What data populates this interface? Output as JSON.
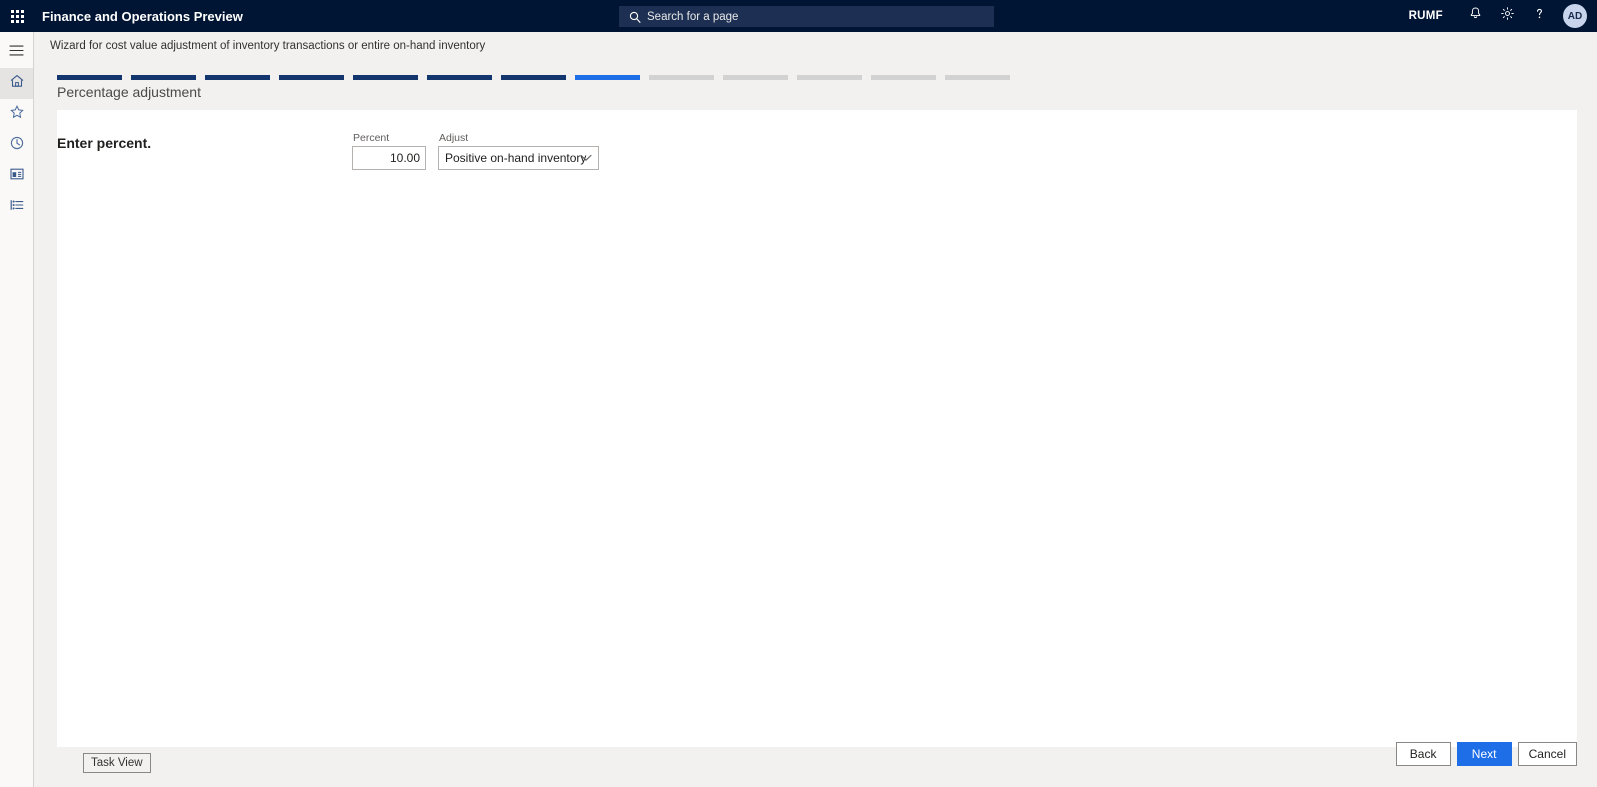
{
  "header": {
    "waffle_icon": "app-launcher-icon",
    "title": "Finance and Operations Preview",
    "search": {
      "icon": "search-icon",
      "placeholder": "Search for a page"
    },
    "company_label": "RUMF",
    "icons": [
      {
        "name": "notifications-bell-icon",
        "glyph": "bell"
      },
      {
        "name": "settings-gear-icon",
        "glyph": "gear"
      },
      {
        "name": "help-question-icon",
        "glyph": "question"
      }
    ],
    "avatar_initials": "AD",
    "colors": {
      "header_background": "#001433",
      "search_background": "#1d3053",
      "avatar_background": "#c7d4ec"
    }
  },
  "nav_rail": {
    "items": [
      {
        "name": "hamburger-menu",
        "icon": "hamburger-icon",
        "active": false
      },
      {
        "name": "home",
        "icon": "home-icon",
        "active": true
      },
      {
        "name": "favorites",
        "icon": "star-icon",
        "active": false
      },
      {
        "name": "recent",
        "icon": "clock-icon",
        "active": false
      },
      {
        "name": "workspaces",
        "icon": "workspace-icon",
        "active": false
      },
      {
        "name": "modules",
        "icon": "modules-list-icon",
        "active": false
      }
    ]
  },
  "breadcrumb": "Wizard for cost value adjustment of inventory transactions or entire on-hand inventory",
  "wizard": {
    "step_title": "Percentage adjustment",
    "total_steps": 13,
    "current_step": 8,
    "steps": [
      {
        "state": "done"
      },
      {
        "state": "done"
      },
      {
        "state": "done"
      },
      {
        "state": "done"
      },
      {
        "state": "done"
      },
      {
        "state": "done"
      },
      {
        "state": "done"
      },
      {
        "state": "current"
      },
      {
        "state": "todo"
      },
      {
        "state": "todo"
      },
      {
        "state": "todo"
      },
      {
        "state": "todo"
      },
      {
        "state": "todo"
      }
    ],
    "colors": {
      "done": "#14366f",
      "current": "#1e6ee8",
      "todo": "#d2d2d2"
    }
  },
  "content": {
    "section_heading": "Enter percent.",
    "fields": {
      "percent": {
        "label": "Percent",
        "value": "10.00"
      },
      "adjust": {
        "label": "Adjust",
        "value": "Positive on-hand inventory",
        "chevron_icon": "chevron-down-icon"
      }
    }
  },
  "footer": {
    "task_view_label": "Task View",
    "back_label": "Back",
    "next_label": "Next",
    "cancel_label": "Cancel",
    "primary_color": "#1e6ee8"
  }
}
